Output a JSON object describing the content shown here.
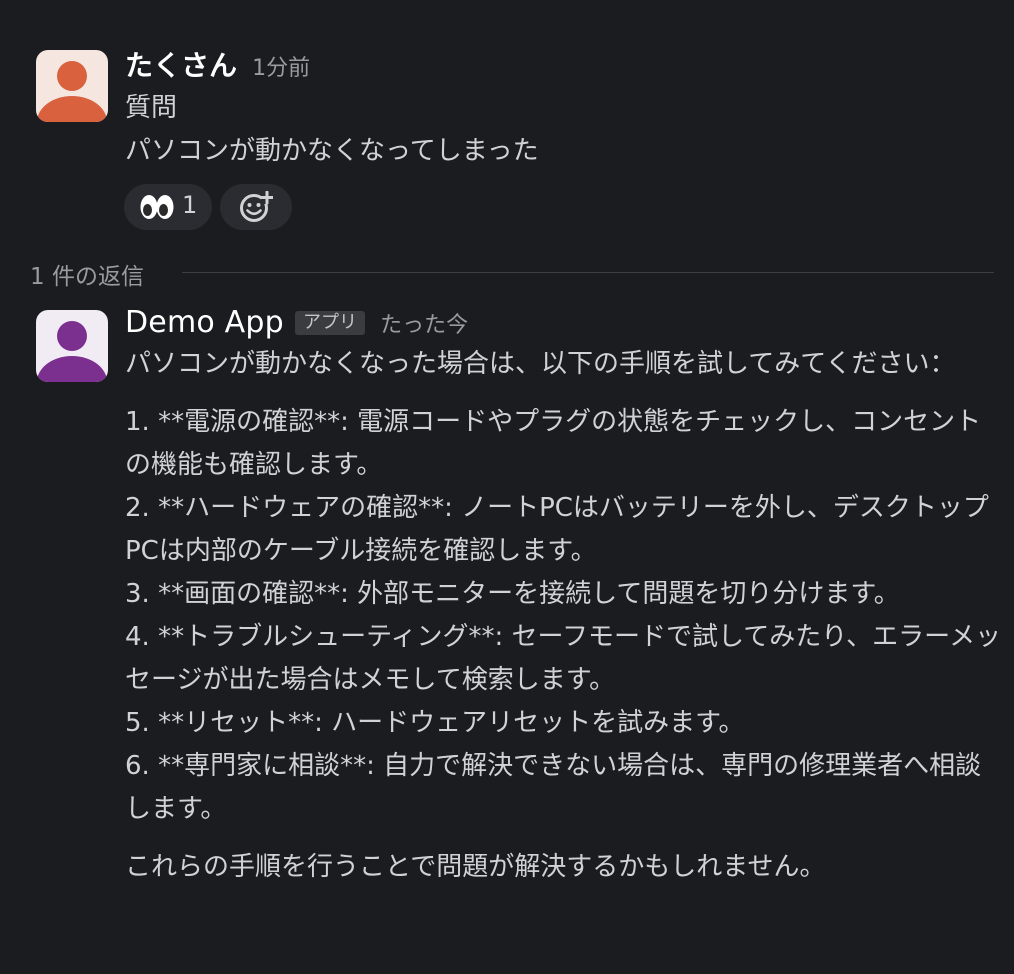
{
  "messages": {
    "user": {
      "author": "たくさん",
      "timestamp": "1分前",
      "lines": [
        "質問",
        "パソコンが動かなくなってしまった"
      ],
      "reactions": {
        "eyes": {
          "emoji": "eyes-emoji",
          "count": "1"
        },
        "add": {
          "icon": "add-reaction-icon"
        }
      }
    },
    "thread": {
      "reply_count_label": "1 件の返信"
    },
    "app": {
      "author": "Demo App",
      "badge": "アプリ",
      "timestamp": "たった今",
      "intro": "パソコンが動かなくなった場合は、以下の手順を試してみてください：",
      "steps": [
        "1. **電源の確認**: 電源コードやプラグの状態をチェックし、コンセントの機能も確認します。",
        "2. **ハードウェアの確認**: ノートPCはバッテリーを外し、デスクトップPCは内部のケーブル接続を確認します。",
        "3. **画面の確認**: 外部モニターを接続して問題を切り分けます。",
        "4. **トラブルシューティング**: セーフモードで試してみたり、エラーメッセージが出た場合はメモして検索します。",
        "5. **リセット**: ハードウェアリセットを試みます。",
        "6. **専門家に相談**: 自力で解決できない場合は、専門の修理業者へ相談します。"
      ],
      "closing": "これらの手順を行うことで問題が解決するかもしれません。"
    }
  },
  "colors": {
    "background": "#1b1c20",
    "text": "#d1d2d3",
    "muted": "#9a9b9e",
    "user_avatar": "#d9613e",
    "app_avatar": "#7b2f8f",
    "reaction_bg": "#2b2c31"
  }
}
